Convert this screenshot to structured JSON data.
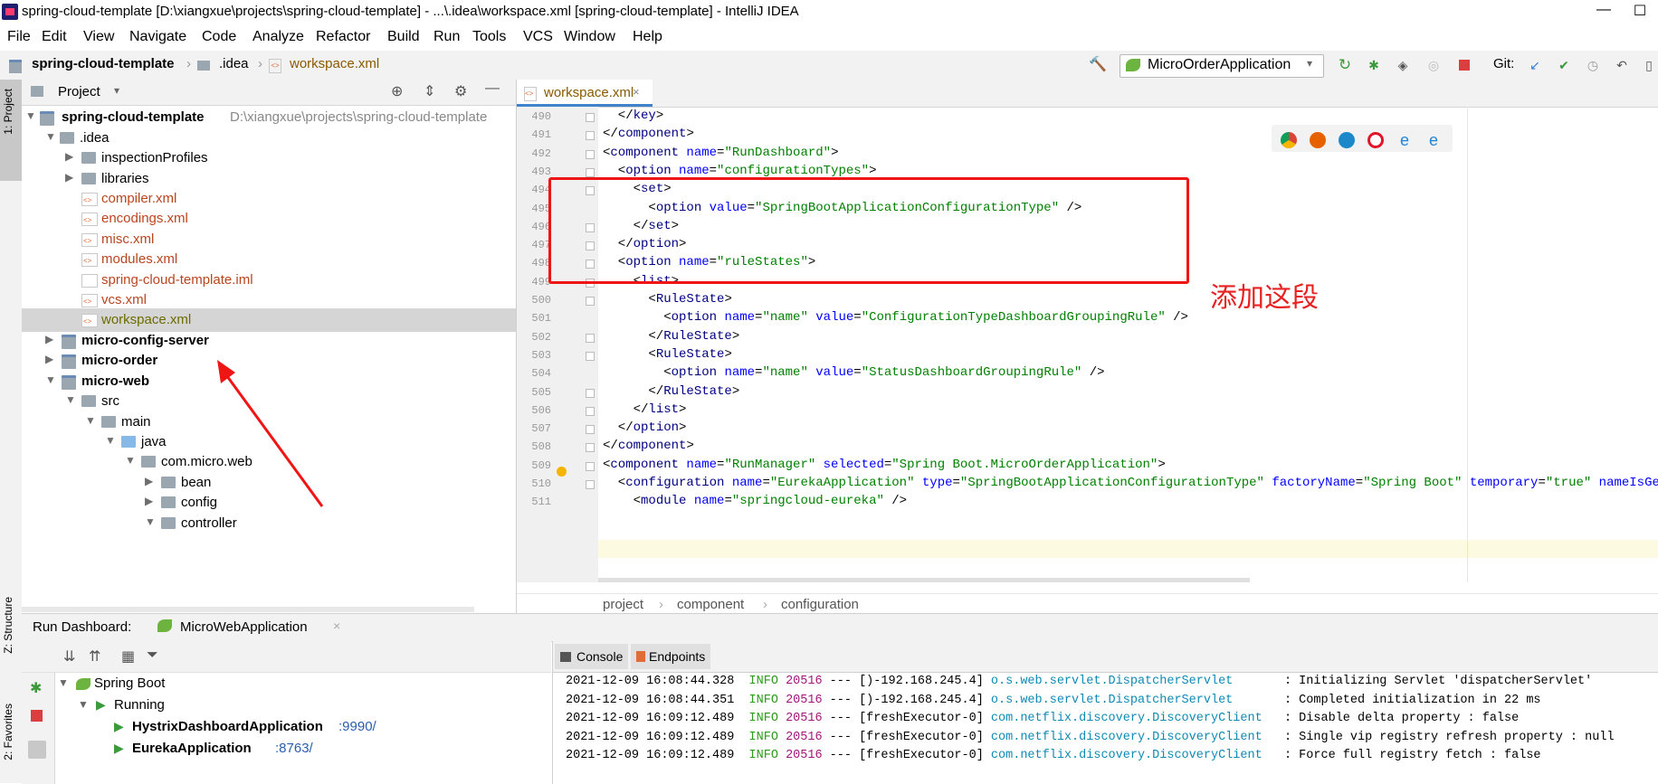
{
  "window": {
    "title": "spring-cloud-template [D:\\xiangxue\\projects\\spring-cloud-template] - ...\\.idea\\workspace.xml [spring-cloud-template] - IntelliJ IDEA",
    "minimize": "—",
    "maximize": "☐"
  },
  "menu": [
    "File",
    "Edit",
    "View",
    "Navigate",
    "Code",
    "Analyze",
    "Refactor",
    "Build",
    "Run",
    "Tools",
    "VCS",
    "Window",
    "Help"
  ],
  "navbar": {
    "crumbs": [
      "spring-cloud-template",
      ".idea",
      "workspace.xml"
    ],
    "run_config": "MicroOrderApplication",
    "git_label": "Git:"
  },
  "sidebar_tabs": {
    "project": "1: Project",
    "structure": "Z: Structure",
    "favorites": "2: Favorites"
  },
  "project": {
    "header": "Project",
    "root_name": "spring-cloud-template",
    "root_path": "D:\\xiangxue\\projects\\spring-cloud-template",
    "items": [
      {
        "label": ".idea"
      },
      {
        "label": "inspectionProfiles"
      },
      {
        "label": "libraries"
      },
      {
        "label": "compiler.xml"
      },
      {
        "label": "encodings.xml"
      },
      {
        "label": "misc.xml"
      },
      {
        "label": "modules.xml"
      },
      {
        "label": "spring-cloud-template.iml"
      },
      {
        "label": "vcs.xml"
      },
      {
        "label": "workspace.xml"
      },
      {
        "label": "micro-config-server"
      },
      {
        "label": "micro-order"
      },
      {
        "label": "micro-web"
      },
      {
        "label": "src"
      },
      {
        "label": "main"
      },
      {
        "label": "java"
      },
      {
        "label": "com.micro.web"
      },
      {
        "label": "bean"
      },
      {
        "label": "config"
      },
      {
        "label": "controller"
      }
    ]
  },
  "editor": {
    "tab": "workspace.xml",
    "breadcrumbs": [
      "project",
      "component",
      "configuration"
    ],
    "line_numbers": [
      "490",
      "491",
      "492",
      "493",
      "494",
      "495",
      "496",
      "497",
      "498",
      "499",
      "500",
      "501",
      "502",
      "503",
      "504",
      "505",
      "506",
      "507",
      "508",
      "509",
      "510",
      "511"
    ]
  },
  "annotation": {
    "text": "添加这段"
  },
  "run_dashboard": {
    "title": "Run Dashboard:",
    "tab": "MicroWebApplication",
    "tree": {
      "root": "Spring Boot",
      "group": "Running",
      "apps": [
        {
          "name": "HystrixDashboardApplication",
          "port": ":9990/"
        },
        {
          "name": "EurekaApplication",
          "port": ":8763/"
        }
      ]
    },
    "console_tabs": [
      "Console",
      "Endpoints"
    ],
    "log": [
      {
        "ts": "2021-12-09 16:08:44.328",
        "lvl": "INFO",
        "pid": "20516",
        "sep": "---",
        "thread": "[)-192.168.245.4]",
        "cls": "o.s.web.servlet.DispatcherServlet",
        "msg": ": Initializing Servlet 'dispatcherServlet'"
      },
      {
        "ts": "2021-12-09 16:08:44.351",
        "lvl": "INFO",
        "pid": "20516",
        "sep": "---",
        "thread": "[)-192.168.245.4]",
        "cls": "o.s.web.servlet.DispatcherServlet",
        "msg": ": Completed initialization in 22 ms"
      },
      {
        "ts": "2021-12-09 16:09:12.489",
        "lvl": "INFO",
        "pid": "20516",
        "sep": "---",
        "thread": "[freshExecutor-0]",
        "cls": "com.netflix.discovery.DiscoveryClient",
        "msg": ": Disable delta property : false"
      },
      {
        "ts": "2021-12-09 16:09:12.489",
        "lvl": "INFO",
        "pid": "20516",
        "sep": "---",
        "thread": "[freshExecutor-0]",
        "cls": "com.netflix.discovery.DiscoveryClient",
        "msg": ": Single vip registry refresh property : null"
      },
      {
        "ts": "2021-12-09 16:09:12.489",
        "lvl": "INFO",
        "pid": "20516",
        "sep": "---",
        "thread": "[freshExecutor-0]",
        "cls": "com.netflix.discovery.DiscoveryClient",
        "msg": ": Force full registry fetch : false"
      }
    ]
  },
  "code_lines": [
    [
      [
        "br",
        "  </"
      ],
      [
        "tag",
        "key"
      ],
      [
        "br",
        ">"
      ]
    ],
    [
      [
        "br",
        "</"
      ],
      [
        "tag",
        "component"
      ],
      [
        "br",
        ">"
      ]
    ],
    [
      [
        "br",
        "<"
      ],
      [
        "tag",
        "component "
      ],
      [
        "attr",
        "name"
      ],
      [
        "br",
        "="
      ],
      [
        "val",
        "\"RunDashboard\""
      ],
      [
        "br",
        ">"
      ]
    ],
    [
      [
        "br",
        "  <"
      ],
      [
        "tag",
        "option "
      ],
      [
        "attr",
        "name"
      ],
      [
        "br",
        "="
      ],
      [
        "val",
        "\"configurationTypes\""
      ],
      [
        "br",
        ">"
      ]
    ],
    [
      [
        "br",
        "    <"
      ],
      [
        "tag",
        "set"
      ],
      [
        "br",
        ">"
      ]
    ],
    [
      [
        "br",
        "      <"
      ],
      [
        "tag",
        "option "
      ],
      [
        "attr",
        "value"
      ],
      [
        "br",
        "="
      ],
      [
        "val",
        "\"SpringBootApplicationConfigurationType\""
      ],
      [
        "br",
        " />"
      ]
    ],
    [
      [
        "br",
        "    </"
      ],
      [
        "tag",
        "set"
      ],
      [
        "br",
        ">"
      ]
    ],
    [
      [
        "br",
        "  </"
      ],
      [
        "tag",
        "option"
      ],
      [
        "br",
        ">"
      ]
    ],
    [
      [
        "br",
        "  <"
      ],
      [
        "tag",
        "option "
      ],
      [
        "attr",
        "name"
      ],
      [
        "br",
        "="
      ],
      [
        "val",
        "\"ruleStates\""
      ],
      [
        "br",
        ">"
      ]
    ],
    [
      [
        "br",
        "    <"
      ],
      [
        "tag",
        "list"
      ],
      [
        "br",
        ">"
      ]
    ],
    [
      [
        "br",
        "      <"
      ],
      [
        "tag",
        "RuleState"
      ],
      [
        "br",
        ">"
      ]
    ],
    [
      [
        "br",
        "        <"
      ],
      [
        "tag",
        "option "
      ],
      [
        "attr",
        "name"
      ],
      [
        "br",
        "="
      ],
      [
        "val",
        "\"name\" "
      ],
      [
        "attr",
        "value"
      ],
      [
        "br",
        "="
      ],
      [
        "val",
        "\"ConfigurationTypeDashboardGroupingRule\""
      ],
      [
        "br",
        " />"
      ]
    ],
    [
      [
        "br",
        "      </"
      ],
      [
        "tag",
        "RuleState"
      ],
      [
        "br",
        ">"
      ]
    ],
    [
      [
        "br",
        "      <"
      ],
      [
        "tag",
        "RuleState"
      ],
      [
        "br",
        ">"
      ]
    ],
    [
      [
        "br",
        "        <"
      ],
      [
        "tag",
        "option "
      ],
      [
        "attr",
        "name"
      ],
      [
        "br",
        "="
      ],
      [
        "val",
        "\"name\" "
      ],
      [
        "attr",
        "value"
      ],
      [
        "br",
        "="
      ],
      [
        "val",
        "\"StatusDashboardGroupingRule\""
      ],
      [
        "br",
        " />"
      ]
    ],
    [
      [
        "br",
        "      </"
      ],
      [
        "tag",
        "RuleState"
      ],
      [
        "br",
        ">"
      ]
    ],
    [
      [
        "br",
        "    </"
      ],
      [
        "tag",
        "list"
      ],
      [
        "br",
        ">"
      ]
    ],
    [
      [
        "br",
        "  </"
      ],
      [
        "tag",
        "option"
      ],
      [
        "br",
        ">"
      ]
    ],
    [
      [
        "br",
        "</"
      ],
      [
        "tag",
        "component"
      ],
      [
        "br",
        ">"
      ]
    ],
    [
      [
        "br",
        "<"
      ],
      [
        "tag",
        "component "
      ],
      [
        "attr",
        "name"
      ],
      [
        "br",
        "="
      ],
      [
        "val",
        "\"RunManager\" "
      ],
      [
        "attr",
        "selected"
      ],
      [
        "br",
        "="
      ],
      [
        "val",
        "\"Spring Boot.MicroOrderApplication\""
      ],
      [
        "br",
        ">"
      ]
    ],
    [
      [
        "br",
        "  <"
      ],
      [
        "tag",
        "configuration "
      ],
      [
        "attr",
        "name"
      ],
      [
        "br",
        "="
      ],
      [
        "val",
        "\"EurekaApplication\" "
      ],
      [
        "attr",
        "type"
      ],
      [
        "br",
        "="
      ],
      [
        "val",
        "\"SpringBootApplicationConfigurationType\" "
      ],
      [
        "attr",
        "factoryName"
      ],
      [
        "br",
        "="
      ],
      [
        "val",
        "\"Spring Boot\" "
      ],
      [
        "attr",
        "temporary"
      ],
      [
        "br",
        "="
      ],
      [
        "val",
        "\"true\" "
      ],
      [
        "attr",
        "nameIsGenerat"
      ]
    ],
    [
      [
        "br",
        "    <"
      ],
      [
        "tag",
        "module "
      ],
      [
        "attr",
        "name"
      ],
      [
        "br",
        "="
      ],
      [
        "val",
        "\"springcloud-eureka\""
      ],
      [
        "br",
        " />"
      ]
    ]
  ]
}
